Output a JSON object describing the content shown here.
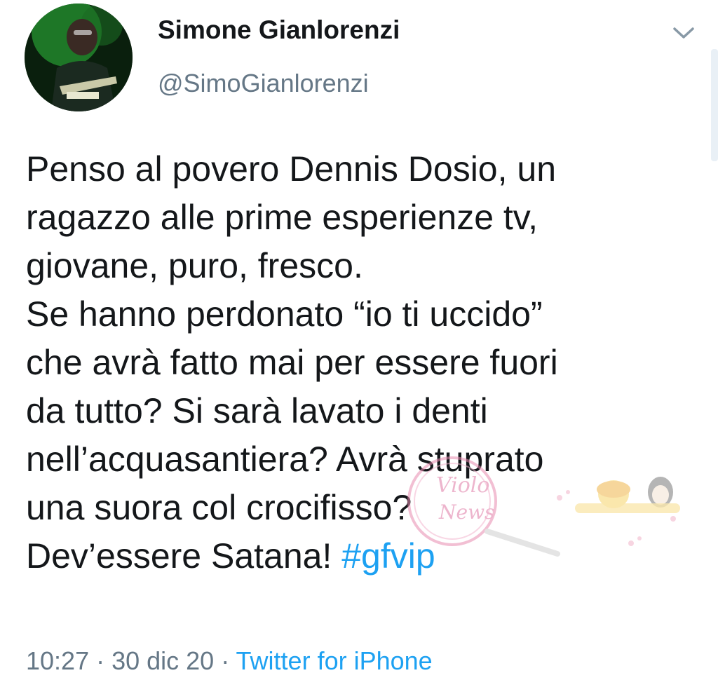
{
  "tweet": {
    "author_name": "Simone Gianlorenzi",
    "author_handle": "@SimoGianlorenzi",
    "body_lines": [
      "Penso al povero Dennis Dosio, un",
      "ragazzo alle prime esperienze tv,",
      "giovane, puro, fresco.",
      "Se hanno perdonato “io ti uccido”",
      "che avrà fatto mai per essere fuori",
      "da tutto? Si sarà lavato i denti",
      "nell’acquasantiera? Avrà stuprato",
      "una suora col crocifisso?"
    ],
    "last_line_text": "Dev’essere Satana! ",
    "hashtag": "#gfvip",
    "time": "10:27",
    "separator": " · ",
    "date": "30 dic 20",
    "source": "Twitter for iPhone"
  },
  "watermark": {
    "text_line1": "Violo",
    "text_line2": "News"
  },
  "colors": {
    "text": "#14171a",
    "secondary": "#657786",
    "link": "#1da1f2"
  },
  "icons": {
    "menu": "chevron-down-icon"
  }
}
